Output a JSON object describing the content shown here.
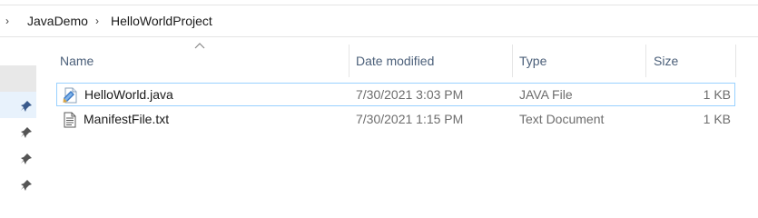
{
  "breadcrumb": {
    "items": [
      "JavaDemo",
      "HelloWorldProject"
    ]
  },
  "columns": {
    "name": "Name",
    "date_modified": "Date modified",
    "type": "Type",
    "size": "Size"
  },
  "files": [
    {
      "name": "HelloWorld.java",
      "date_modified": "7/30/2021 3:03 PM",
      "type": "JAVA File",
      "size": "1 KB",
      "icon": "java-file-icon",
      "selected": true
    },
    {
      "name": "ManifestFile.txt",
      "date_modified": "7/30/2021 1:15 PM",
      "type": "Text Document",
      "size": "1 KB",
      "icon": "text-file-icon",
      "selected": false
    }
  ],
  "colors": {
    "selection_border": "#99d1ff",
    "header_text": "#4c607a",
    "meta_text": "#6d6d6d"
  }
}
